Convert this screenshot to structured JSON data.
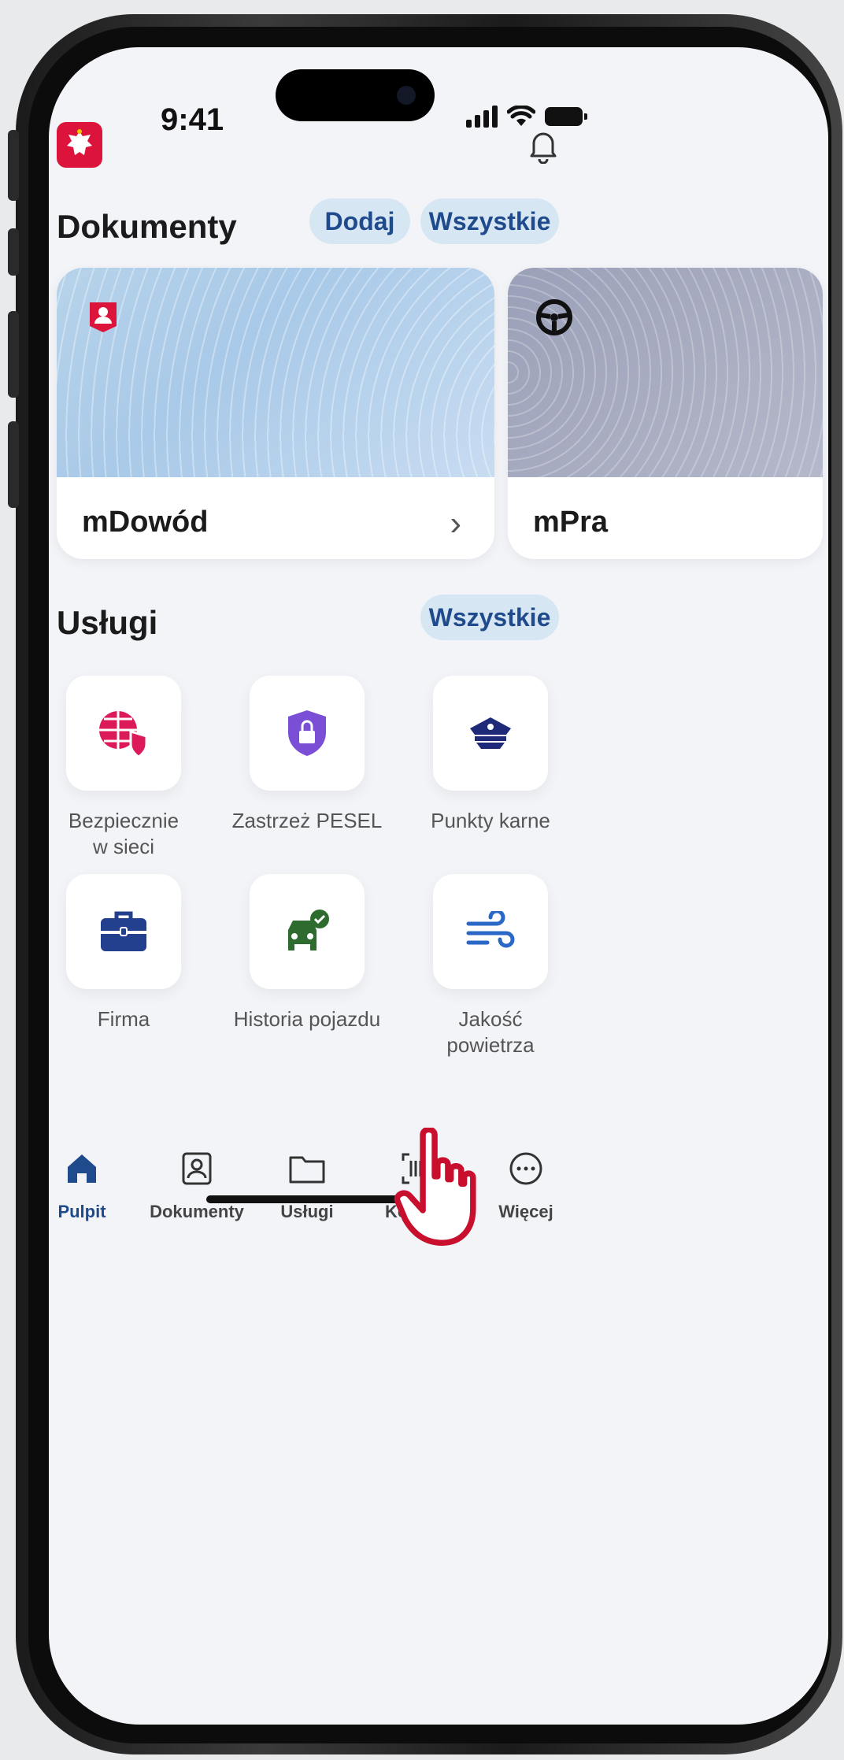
{
  "status_bar": {
    "time": "9:41"
  },
  "documents": {
    "title": "Dokumenty",
    "add_label": "Dodaj",
    "all_label": "Wszystkie",
    "cards": [
      {
        "title": "mDowód",
        "icon": "id-card-icon"
      },
      {
        "title": "mPra",
        "icon": "steering-wheel-icon"
      }
    ]
  },
  "services": {
    "title": "Usługi",
    "all_label": "Wszystkie",
    "items": [
      {
        "label": "Bezpiecznie\nw sieci",
        "icon": "globe-shield-icon",
        "color": "#dc1a5a"
      },
      {
        "label": "Zastrzeż PESEL",
        "icon": "lock-shield-icon",
        "color": "#7b4ed6"
      },
      {
        "label": "Punkty karne",
        "icon": "police-cap-icon",
        "color": "#1e2a78"
      },
      {
        "label": "Firma",
        "icon": "briefcase-icon",
        "color": "#23408f"
      },
      {
        "label": "Historia pojazdu",
        "icon": "car-check-icon",
        "color": "#2d6b2f"
      },
      {
        "label": "Jakość\npowietrza",
        "icon": "wind-icon",
        "color": "#2a67c6"
      }
    ]
  },
  "nav": {
    "items": [
      {
        "label": "Pulpit",
        "active": true
      },
      {
        "label": "Dokumenty"
      },
      {
        "label": "Usługi"
      },
      {
        "label": "Kod QR"
      },
      {
        "label": "Więcej"
      }
    ]
  },
  "colors": {
    "accent": "#1f4b8d",
    "pill_bg": "#d7e6f3",
    "emblem_red": "#dc143c",
    "pointer_red": "#c8102e"
  }
}
